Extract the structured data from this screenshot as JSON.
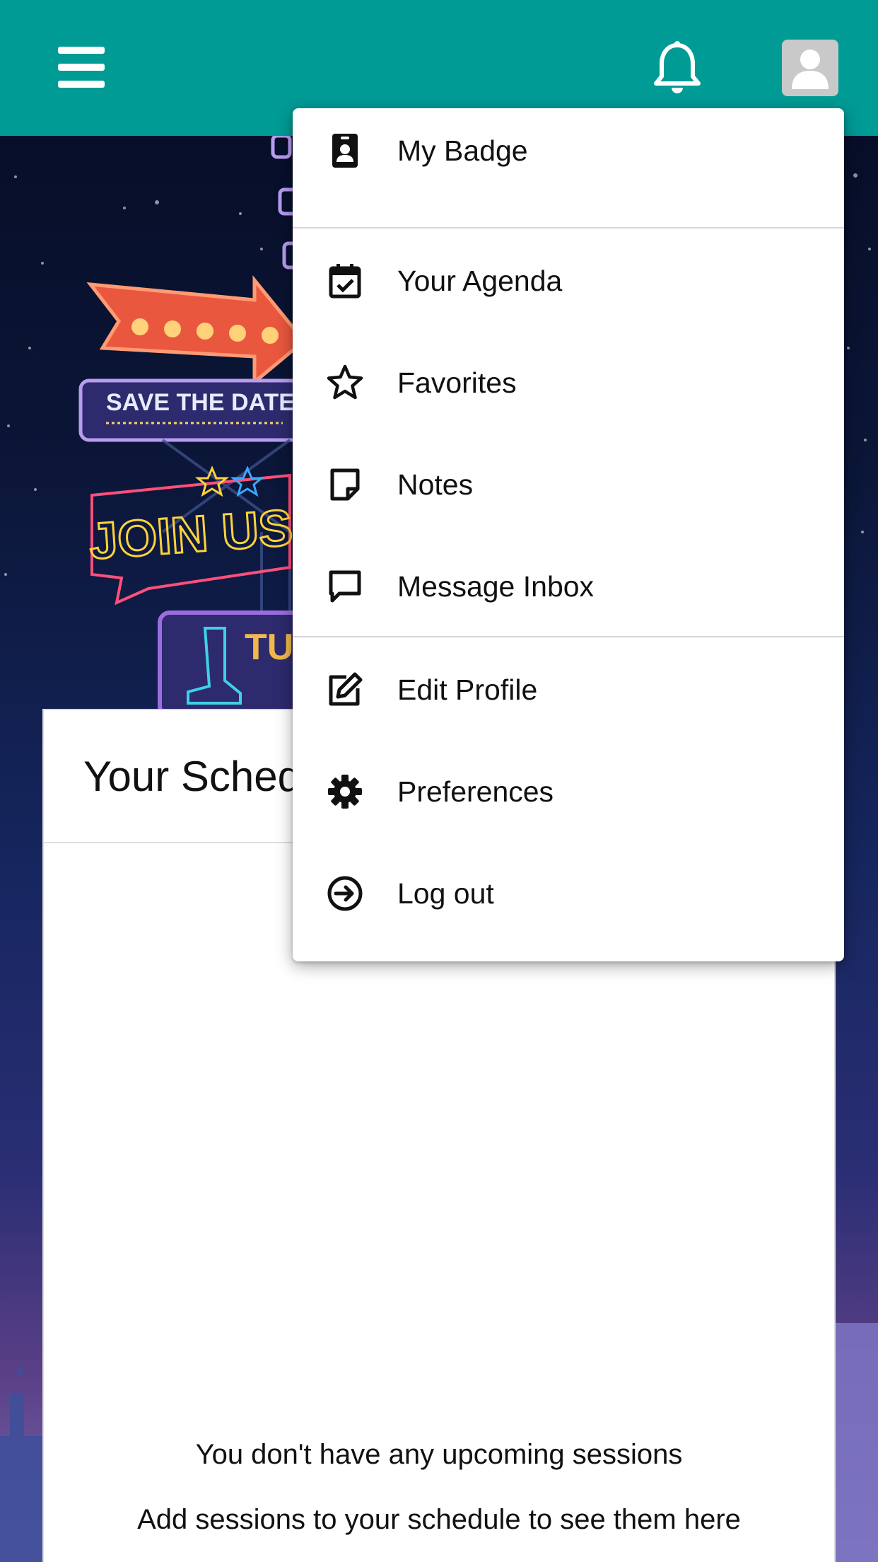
{
  "topbar": {
    "background_color": "#009b95",
    "menu_icon": "hamburger-menu-icon",
    "notifications_icon": "bell-icon",
    "profile_icon": "user-avatar-icon"
  },
  "user_menu": {
    "items": [
      {
        "label": "My Badge",
        "icon": "badge-icon"
      },
      {
        "label": "Your Agenda",
        "icon": "calendar-check-icon"
      },
      {
        "label": "Favorites",
        "icon": "star-icon"
      },
      {
        "label": "Notes",
        "icon": "sticky-note-icon"
      },
      {
        "label": "Message Inbox",
        "icon": "message-bubble-icon"
      },
      {
        "label": "Edit Profile",
        "icon": "edit-icon"
      },
      {
        "label": "Preferences",
        "icon": "gear-icon"
      },
      {
        "label": "Log out",
        "icon": "logout-arrow-icon"
      }
    ]
  },
  "hero": {
    "sign_save_the_date": "SAVE THE DATE",
    "sign_join_us": "JOIN US!",
    "sign_partial": "TU"
  },
  "schedule": {
    "title": "Your Schedule",
    "empty_message": "You don't have any upcoming sessions",
    "empty_hint": "Add sessions to your schedule to see them here"
  }
}
